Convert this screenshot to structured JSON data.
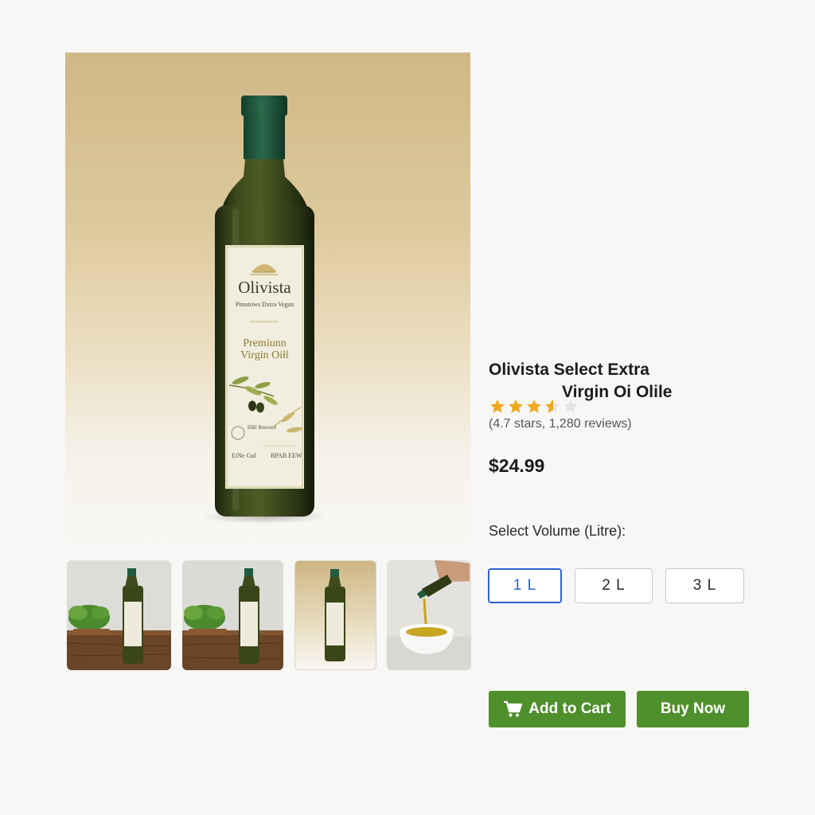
{
  "product": {
    "title_line1": "Olivista Select Extra",
    "title_line2": "Virgin Oi Olile",
    "rating_value": 4.7,
    "rating_max": 5,
    "reviews_text": "(4.7 stars, 1,280 reviews)",
    "price": "$24.99"
  },
  "label": {
    "brand": "Olivista",
    "subtitle": "Pimstows Dxtra Vegan",
    "line1": "Premiunn",
    "line2": "Virgin Oiłl",
    "stamp": "EBE Bosrved",
    "bottom_left": "EiNe Gul",
    "bottom_right": "BPAB EEW"
  },
  "volume": {
    "label": "Select Volume (Litre):",
    "options": [
      "1 L",
      "2 L",
      "3 L"
    ],
    "selected": "1 L"
  },
  "actions": {
    "add_to_cart": "Add to Cart",
    "buy_now": "Buy Now"
  },
  "thumbnails": [
    {
      "icon": "bottle-on-wooden-table-with-herbs"
    },
    {
      "icon": "bottle-on-wooden-table-with-herbs"
    },
    {
      "icon": "bottle-on-beige-gradient"
    },
    {
      "icon": "oil-pouring-into-bowl"
    }
  ],
  "colors": {
    "accent_blue": "#2e63d4",
    "button_green": "#4f8f2c",
    "star_gold": "#f0a81c",
    "bottle_cap": "#1f5b3e"
  }
}
